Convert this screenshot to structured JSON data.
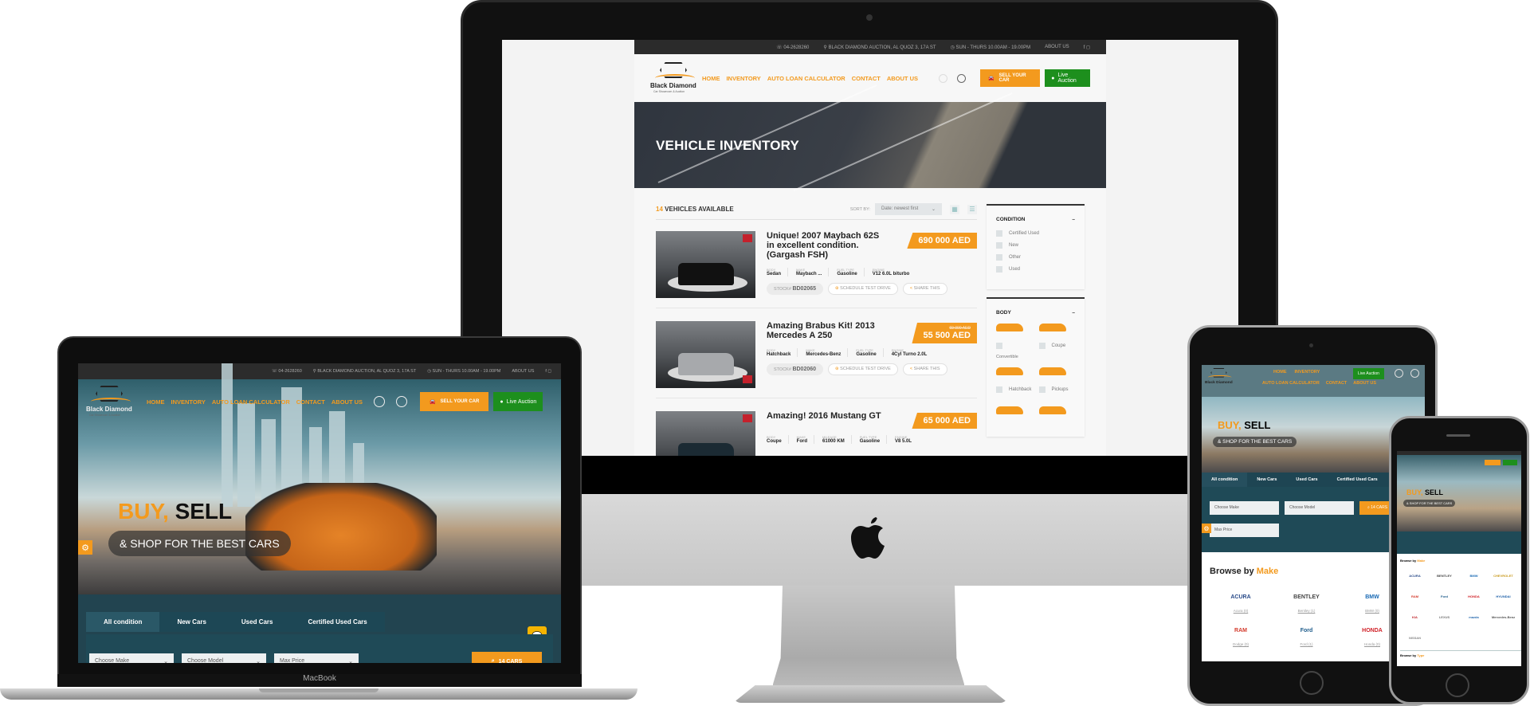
{
  "brand": {
    "name": "Black Diamond",
    "tagline": "Car Showroom & Auction"
  },
  "topbar": {
    "phone": "04-2628260",
    "address": "BLACK DIAMOND AUCTION, AL QUOZ 3, 17A ST",
    "hours": "SUN - THURS 10.00AM - 19.00PM",
    "about": "ABOUT US"
  },
  "nav": [
    "HOME",
    "INVENTORY",
    "AUTO LOAN CALCULATOR",
    "CONTACT",
    "ABOUT US"
  ],
  "buttons": {
    "sell_your_car": "SELL YOUR CAR",
    "live_auction": "Live Auction"
  },
  "inventory": {
    "title": "VEHICLE INVENTORY",
    "count": "14",
    "count_label": "VEHICLES AVAILABLE",
    "sort_label": "SORT BY:",
    "sort_value": "Date: newest first",
    "vehicles": [
      {
        "title": "Unique! 2007 Maybach 62S in excellent condition. (Gargash FSH)",
        "price": "690 000 AED",
        "old_price": "",
        "specs": [
          {
            "label": "BODY",
            "value": "Sedan"
          },
          {
            "label": "MAKE",
            "value": "Maybach ..."
          },
          {
            "label": "FUEL TYPE",
            "value": "Gasoline"
          },
          {
            "label": "ENGINE",
            "value": "V12 6.0L biturbo"
          }
        ],
        "stock_label": "STOCK#",
        "stock": "BD02065",
        "schedule": "SCHEDULE TEST DRIVE",
        "share": "SHARE THIS"
      },
      {
        "title": "Amazing Brabus Kit! 2013 Mercedes A 250",
        "price": "55 500 AED",
        "old_price": "69 000 AED",
        "specs": [
          {
            "label": "BODY",
            "value": "Hatchback"
          },
          {
            "label": "MAKE",
            "value": "Mercedes-Benz"
          },
          {
            "label": "FUEL TYPE",
            "value": "Gasoline"
          },
          {
            "label": "ENGINE",
            "value": "4Cyl Turno 2.0L"
          }
        ],
        "stock_label": "STOCK#",
        "stock": "BD02060",
        "schedule": "SCHEDULE TEST DRIVE",
        "share": "SHARE THIS"
      },
      {
        "title": "Amazing! 2016 Mustang GT",
        "price": "65 000 AED",
        "old_price": "",
        "specs": [
          {
            "label": "BODY",
            "value": "Coupe"
          },
          {
            "label": "MAKE",
            "value": "Ford"
          },
          {
            "label": "MILEAGE",
            "value": "61000 KM"
          },
          {
            "label": "FUEL TYPE",
            "value": "Gasoline"
          },
          {
            "label": "ENGINE",
            "value": "V8 5.0L"
          }
        ]
      }
    ]
  },
  "filters": {
    "condition_title": "CONDITION",
    "condition": [
      "Certified Used",
      "New",
      "Other",
      "Used"
    ],
    "body_title": "BODY",
    "body": [
      "Convertible",
      "Coupe",
      "Hatchback",
      "Pickups"
    ]
  },
  "home": {
    "buy": "BUY,",
    "sell": "SELL",
    "tagline": "& SHOP FOR THE BEST CARS",
    "tabs": [
      "All condition",
      "New Cars",
      "Used Cars",
      "Certified Used Cars"
    ],
    "make_placeholder": "Choose Make",
    "model_placeholder": "Choose Model",
    "price_placeholder": "Max Price",
    "search_button": "14 CARS",
    "browse_prefix": "Browse by",
    "browse_make": "Make",
    "browse_type": "Type",
    "brands": [
      {
        "name": "ACURA",
        "count": "Acura (0)",
        "color": "#2b4c8a"
      },
      {
        "name": "BENTLEY",
        "count": "Bentley (1)",
        "color": "#444444"
      },
      {
        "name": "BMW",
        "count": "BMW (0)",
        "color": "#1b6bb5"
      },
      {
        "name": "CHEVROLET",
        "count": "Chevrolet (0)",
        "color": "#c99a1e"
      },
      {
        "name": "RAM",
        "count": "Dodge (0)",
        "color": "#d43a2c"
      },
      {
        "name": "Ford",
        "count": "Ford (1)",
        "color": "#1b5a8a"
      },
      {
        "name": "HONDA",
        "count": "Honda (0)",
        "color": "#d01f26"
      },
      {
        "name": "HYUNDAI",
        "count": "Hyundai (0)",
        "color": "#1c5fa8"
      },
      {
        "name": "KIA",
        "count": "Kia (0)",
        "color": "#c1272d"
      },
      {
        "name": "LEXUS",
        "count": "Lexus (0)",
        "color": "#777777"
      },
      {
        "name": "mazda",
        "count": "Mazda (0)",
        "color": "#2b6cb0"
      },
      {
        "name": "Mercedes-Benz",
        "count": "Mercedes-Benz (1)",
        "color": "#555555"
      },
      {
        "name": "NISSAN",
        "count": "Nissan (0)",
        "color": "#888888"
      }
    ]
  },
  "devices": {
    "laptop_label": "MacBook"
  },
  "colors": {
    "accent": "#f39a1e",
    "live": "#1d8f1d",
    "dark_teal": "#1f4a57"
  }
}
